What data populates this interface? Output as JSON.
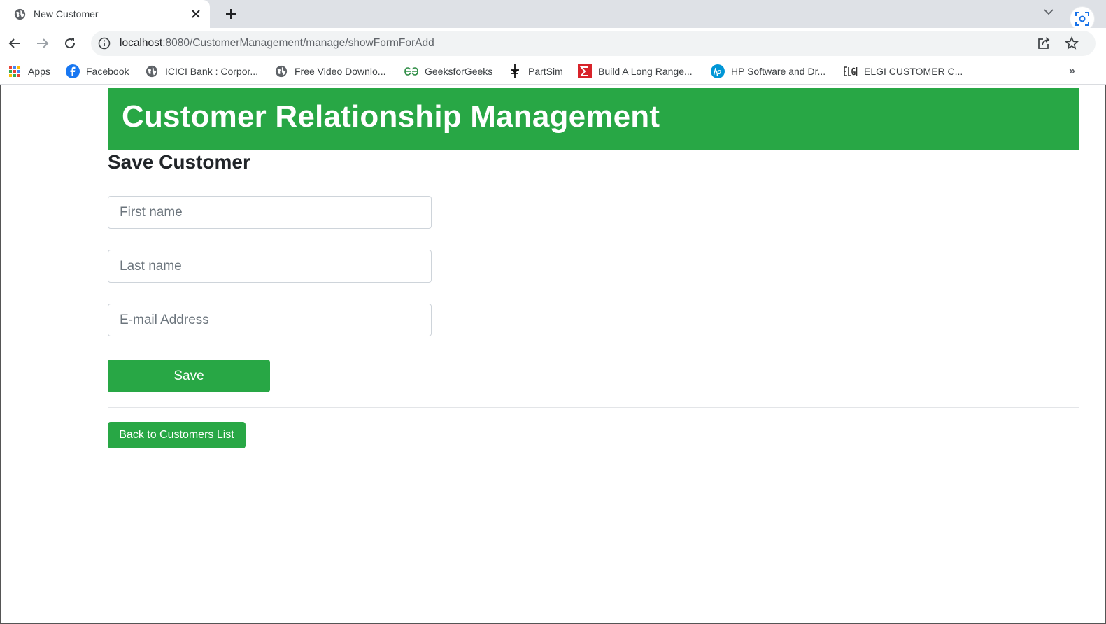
{
  "browser": {
    "tab_title": "New Customer",
    "url_host": "localhost",
    "url_path": ":8080/CustomerManagement/manage/showFormForAdd",
    "bookmarks": [
      {
        "label": "Apps",
        "icon": "apps-grid-icon"
      },
      {
        "label": "Facebook",
        "icon": "facebook-icon"
      },
      {
        "label": "ICICI Bank : Corpor...",
        "icon": "globe-icon"
      },
      {
        "label": "Free Video Downlo...",
        "icon": "globe-icon"
      },
      {
        "label": "GeeksforGeeks",
        "icon": "geeksforgeeks-icon"
      },
      {
        "label": "PartSim",
        "icon": "partsim-icon"
      },
      {
        "label": "Build A Long Range...",
        "icon": "sigma-icon"
      },
      {
        "label": "HP Software and Dr...",
        "icon": "hp-icon"
      },
      {
        "label": "ELGI CUSTOMER C...",
        "icon": "elgi-icon"
      }
    ],
    "more_bookmarks": "»"
  },
  "header": {
    "title": "Customer Relationship Management"
  },
  "form": {
    "title": "Save Customer",
    "first_name_placeholder": "First name",
    "last_name_placeholder": "Last name",
    "email_placeholder": "E-mail Address",
    "save_label": "Save"
  },
  "links": {
    "back_label": "Back to Customers List"
  },
  "colors": {
    "brand": "#28a745",
    "chrome_bg": "#dee1e6",
    "omnibox_bg": "#f1f3f4"
  }
}
